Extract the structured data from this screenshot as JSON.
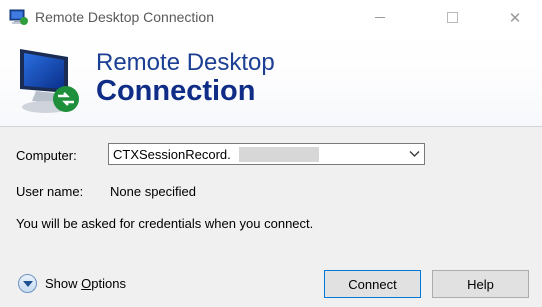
{
  "window": {
    "title": "Remote Desktop Connection",
    "controls": [
      "minimize",
      "maximize",
      "close"
    ],
    "close_glyph": "✕"
  },
  "banner": {
    "line1": "Remote Desktop",
    "line2": "Connection",
    "icon": "remote-desktop-monitor-icon"
  },
  "form": {
    "computer_label": "Computer:",
    "computer_value": "CTXSessionRecord.",
    "username_label": "User name:",
    "username_value": "None specified",
    "credentials_note": "You will be asked for credentials when you connect."
  },
  "footer": {
    "show_options_prefix": "Show ",
    "show_options_mnemonic": "O",
    "show_options_suffix": "ptions",
    "connect_label": "Connect",
    "help_label": "Help"
  },
  "colors": {
    "banner_text": "#1b3f93",
    "banner_bold": "#0f2d86",
    "focus_border": "#0078d7"
  }
}
